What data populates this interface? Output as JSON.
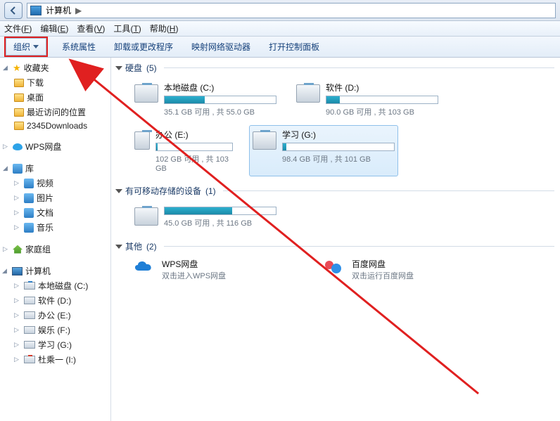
{
  "address": {
    "root": "计算机",
    "separator": "▶"
  },
  "menubar": {
    "file": {
      "label": "文件",
      "mne": "F"
    },
    "edit": {
      "label": "编辑",
      "mne": "E"
    },
    "view": {
      "label": "查看",
      "mne": "V"
    },
    "tools": {
      "label": "工具",
      "mne": "T"
    },
    "help": {
      "label": "帮助",
      "mne": "H"
    }
  },
  "toolbar": {
    "organize": "组织",
    "sys_props": "系统属性",
    "uninstall": "卸载或更改程序",
    "map_drive": "映射网络驱动器",
    "control_panel": "打开控制面板"
  },
  "sidebar": {
    "favorites": {
      "label": "收藏夹",
      "items": [
        {
          "label": "下载"
        },
        {
          "label": "桌面"
        },
        {
          "label": "最近访问的位置"
        },
        {
          "label": "2345Downloads"
        }
      ]
    },
    "wps": {
      "label": "WPS网盘"
    },
    "libraries": {
      "label": "库",
      "items": [
        {
          "label": "视频"
        },
        {
          "label": "图片"
        },
        {
          "label": "文档"
        },
        {
          "label": "音乐"
        }
      ]
    },
    "homegroup": {
      "label": "家庭组"
    },
    "computer": {
      "label": "计算机",
      "items": [
        {
          "label": "本地磁盘 (C:)"
        },
        {
          "label": "软件 (D:)"
        },
        {
          "label": "办公 (E:)"
        },
        {
          "label": "娱乐 (F:)"
        },
        {
          "label": "学习 (G:)"
        },
        {
          "label": "杜乘一 (I:)"
        }
      ]
    }
  },
  "sections": {
    "drives": {
      "label": "硬盘",
      "count": "(5)"
    },
    "removable": {
      "label": "有可移动存储的设备",
      "count": "(1)"
    },
    "other": {
      "label": "其他",
      "count": "(2)"
    }
  },
  "drives": [
    {
      "title": "本地磁盘 (C:)",
      "sub": "35.1 GB 可用 , 共 55.0 GB",
      "fill": 36
    },
    {
      "title": "软件 (D:)",
      "sub": "90.0 GB 可用 , 共 103 GB",
      "fill": 12
    },
    {
      "title": "办公 (E:)",
      "sub": "102 GB 可用 , 共 103 GB",
      "fill": 2
    },
    {
      "title": "学习 (G:)",
      "sub": "98.4 GB 可用 , 共 101 GB",
      "fill": 3,
      "selected": true
    }
  ],
  "removable": [
    {
      "title": "",
      "sub": "45.0 GB 可用 , 共 116 GB",
      "fill": 61
    }
  ],
  "other": [
    {
      "title": "WPS网盘",
      "sub": "双击进入WPS网盘"
    },
    {
      "title": "百度网盘",
      "sub": "双击运行百度网盘"
    }
  ]
}
